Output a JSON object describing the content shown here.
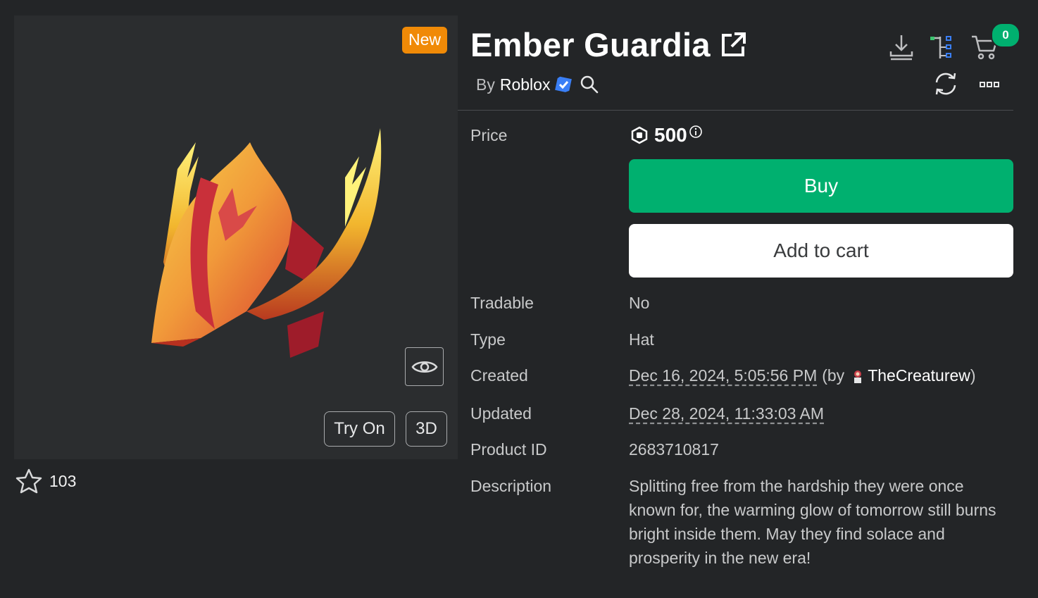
{
  "item": {
    "title": "Ember Guardia",
    "badge": "New",
    "by_prefix": "By",
    "creator": "Roblox",
    "favorites": "103"
  },
  "preview": {
    "try_on_label": "Try On",
    "three_d_label": "3D"
  },
  "header": {
    "cart_count": "0"
  },
  "price": {
    "label": "Price",
    "amount": "500",
    "currency_icon": "robux-icon"
  },
  "buttons": {
    "buy": "Buy",
    "add_to_cart": "Add to cart"
  },
  "details": {
    "tradable_label": "Tradable",
    "tradable_value": "No",
    "type_label": "Type",
    "type_value": "Hat",
    "created_label": "Created",
    "created_date": "Dec 16, 2024, 5:05:56 PM",
    "created_by_prefix": "(by",
    "created_by_user": "TheCreaturew",
    "created_by_suffix": ")",
    "updated_label": "Updated",
    "updated_date": "Dec 28, 2024, 11:33:03 AM",
    "product_id_label": "Product ID",
    "product_id_value": "2683710817",
    "description_label": "Description",
    "description_value": "Splitting free from the hardship they were once known for, the warming glow of tomorrow still burns bright inside them. May they find solace and prosperity in the new era!"
  },
  "colors": {
    "background": "#232527",
    "accent_green": "#00b06f",
    "new_badge": "#f08a07",
    "verified_blue": "#3a7ff6"
  }
}
